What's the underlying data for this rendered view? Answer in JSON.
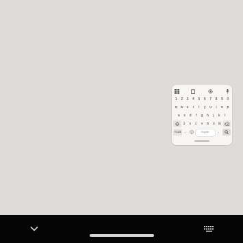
{
  "keyboard": {
    "number_row": [
      "1",
      "2",
      "3",
      "4",
      "5",
      "6",
      "7",
      "8",
      "9",
      "0"
    ],
    "row_q": [
      "q",
      "w",
      "e",
      "r",
      "t",
      "y",
      "u",
      "i",
      "o",
      "p"
    ],
    "row_a": [
      "a",
      "s",
      "d",
      "f",
      "g",
      "h",
      "j",
      "k",
      "l"
    ],
    "row_z": [
      "z",
      "x",
      "c",
      "v",
      "b",
      "n",
      "m"
    ],
    "symbols_label": "?123",
    "space_label": "English"
  },
  "icons": {
    "toolbar": [
      "apps-grid-icon",
      "clipboard-icon",
      "settings-gear-icon",
      "microphone-icon"
    ],
    "shift": "shift-icon",
    "backspace": "backspace-icon",
    "emoji": "emoji-icon",
    "comma": ",",
    "period": ".",
    "search": "search-icon"
  },
  "navigation": {
    "back": "chevron-down-icon",
    "keyboard_switch": "keyboard-icon"
  }
}
